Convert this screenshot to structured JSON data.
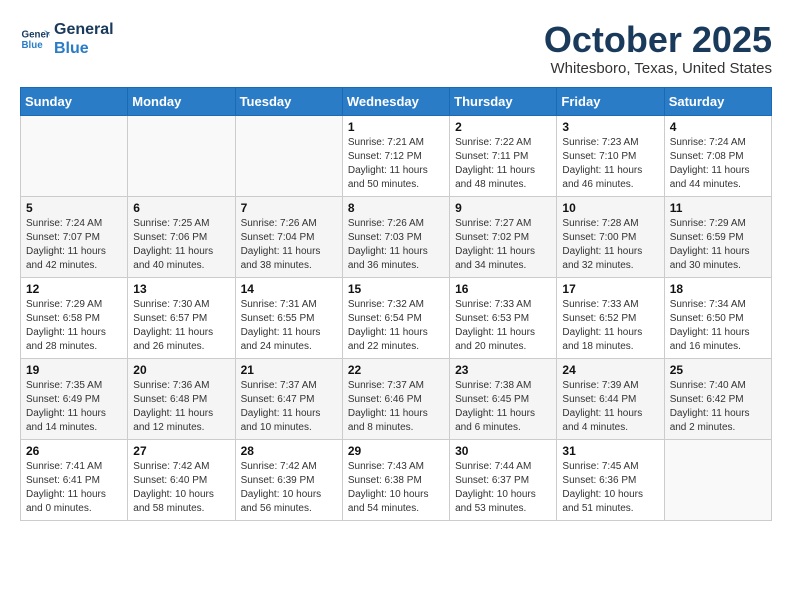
{
  "header": {
    "logo_line1": "General",
    "logo_line2": "Blue",
    "month": "October 2025",
    "location": "Whitesboro, Texas, United States"
  },
  "days_of_week": [
    "Sunday",
    "Monday",
    "Tuesday",
    "Wednesday",
    "Thursday",
    "Friday",
    "Saturday"
  ],
  "weeks": [
    [
      {
        "day": "",
        "info": ""
      },
      {
        "day": "",
        "info": ""
      },
      {
        "day": "",
        "info": ""
      },
      {
        "day": "1",
        "info": "Sunrise: 7:21 AM\nSunset: 7:12 PM\nDaylight: 11 hours and 50 minutes."
      },
      {
        "day": "2",
        "info": "Sunrise: 7:22 AM\nSunset: 7:11 PM\nDaylight: 11 hours and 48 minutes."
      },
      {
        "day": "3",
        "info": "Sunrise: 7:23 AM\nSunset: 7:10 PM\nDaylight: 11 hours and 46 minutes."
      },
      {
        "day": "4",
        "info": "Sunrise: 7:24 AM\nSunset: 7:08 PM\nDaylight: 11 hours and 44 minutes."
      }
    ],
    [
      {
        "day": "5",
        "info": "Sunrise: 7:24 AM\nSunset: 7:07 PM\nDaylight: 11 hours and 42 minutes."
      },
      {
        "day": "6",
        "info": "Sunrise: 7:25 AM\nSunset: 7:06 PM\nDaylight: 11 hours and 40 minutes."
      },
      {
        "day": "7",
        "info": "Sunrise: 7:26 AM\nSunset: 7:04 PM\nDaylight: 11 hours and 38 minutes."
      },
      {
        "day": "8",
        "info": "Sunrise: 7:26 AM\nSunset: 7:03 PM\nDaylight: 11 hours and 36 minutes."
      },
      {
        "day": "9",
        "info": "Sunrise: 7:27 AM\nSunset: 7:02 PM\nDaylight: 11 hours and 34 minutes."
      },
      {
        "day": "10",
        "info": "Sunrise: 7:28 AM\nSunset: 7:00 PM\nDaylight: 11 hours and 32 minutes."
      },
      {
        "day": "11",
        "info": "Sunrise: 7:29 AM\nSunset: 6:59 PM\nDaylight: 11 hours and 30 minutes."
      }
    ],
    [
      {
        "day": "12",
        "info": "Sunrise: 7:29 AM\nSunset: 6:58 PM\nDaylight: 11 hours and 28 minutes."
      },
      {
        "day": "13",
        "info": "Sunrise: 7:30 AM\nSunset: 6:57 PM\nDaylight: 11 hours and 26 minutes."
      },
      {
        "day": "14",
        "info": "Sunrise: 7:31 AM\nSunset: 6:55 PM\nDaylight: 11 hours and 24 minutes."
      },
      {
        "day": "15",
        "info": "Sunrise: 7:32 AM\nSunset: 6:54 PM\nDaylight: 11 hours and 22 minutes."
      },
      {
        "day": "16",
        "info": "Sunrise: 7:33 AM\nSunset: 6:53 PM\nDaylight: 11 hours and 20 minutes."
      },
      {
        "day": "17",
        "info": "Sunrise: 7:33 AM\nSunset: 6:52 PM\nDaylight: 11 hours and 18 minutes."
      },
      {
        "day": "18",
        "info": "Sunrise: 7:34 AM\nSunset: 6:50 PM\nDaylight: 11 hours and 16 minutes."
      }
    ],
    [
      {
        "day": "19",
        "info": "Sunrise: 7:35 AM\nSunset: 6:49 PM\nDaylight: 11 hours and 14 minutes."
      },
      {
        "day": "20",
        "info": "Sunrise: 7:36 AM\nSunset: 6:48 PM\nDaylight: 11 hours and 12 minutes."
      },
      {
        "day": "21",
        "info": "Sunrise: 7:37 AM\nSunset: 6:47 PM\nDaylight: 11 hours and 10 minutes."
      },
      {
        "day": "22",
        "info": "Sunrise: 7:37 AM\nSunset: 6:46 PM\nDaylight: 11 hours and 8 minutes."
      },
      {
        "day": "23",
        "info": "Sunrise: 7:38 AM\nSunset: 6:45 PM\nDaylight: 11 hours and 6 minutes."
      },
      {
        "day": "24",
        "info": "Sunrise: 7:39 AM\nSunset: 6:44 PM\nDaylight: 11 hours and 4 minutes."
      },
      {
        "day": "25",
        "info": "Sunrise: 7:40 AM\nSunset: 6:42 PM\nDaylight: 11 hours and 2 minutes."
      }
    ],
    [
      {
        "day": "26",
        "info": "Sunrise: 7:41 AM\nSunset: 6:41 PM\nDaylight: 11 hours and 0 minutes."
      },
      {
        "day": "27",
        "info": "Sunrise: 7:42 AM\nSunset: 6:40 PM\nDaylight: 10 hours and 58 minutes."
      },
      {
        "day": "28",
        "info": "Sunrise: 7:42 AM\nSunset: 6:39 PM\nDaylight: 10 hours and 56 minutes."
      },
      {
        "day": "29",
        "info": "Sunrise: 7:43 AM\nSunset: 6:38 PM\nDaylight: 10 hours and 54 minutes."
      },
      {
        "day": "30",
        "info": "Sunrise: 7:44 AM\nSunset: 6:37 PM\nDaylight: 10 hours and 53 minutes."
      },
      {
        "day": "31",
        "info": "Sunrise: 7:45 AM\nSunset: 6:36 PM\nDaylight: 10 hours and 51 minutes."
      },
      {
        "day": "",
        "info": ""
      }
    ]
  ]
}
